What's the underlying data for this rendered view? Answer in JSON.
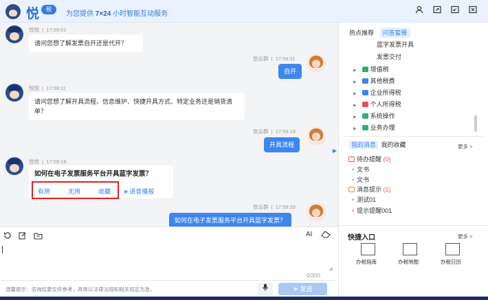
{
  "header": {
    "logo_text": "悦",
    "logo_badge": "税",
    "tagline_prefix": "为您提供",
    "tagline_hours": "7×24",
    "tagline_suffix": "小时智能互动服务",
    "icons": [
      "user-icon",
      "expand-icon",
      "minimize-icon",
      "close-icon"
    ]
  },
  "chat": {
    "messages": [
      {
        "sender": "悦悦",
        "time": "17:59:01",
        "text": "请问您想了解发票自开还是代开？"
      },
      {
        "sender": "张云群",
        "time": "17:59:11",
        "text": "自开"
      },
      {
        "sender": "悦悦",
        "time": "17:59:11",
        "text": "请问您想了解开具流程、信息维护、快捷开具方式、特定业务还是销货清单？"
      },
      {
        "sender": "张云群",
        "time": "17:59:18",
        "text": "开具流程"
      },
      {
        "sender": "悦悦",
        "time": "17:59:18",
        "text": "如何在电子发票服务平台开具蓝字发票？"
      },
      {
        "sender": "张云群",
        "time": "17:59:26",
        "text": "如何在电子发票服务平台开具蓝字发票？"
      }
    ],
    "actions": {
      "useful": "有用",
      "useless": "无用",
      "favorite": "收藏",
      "voice": "语音播报"
    },
    "sep": "|"
  },
  "right_panel": {
    "tabs": [
      "热点推荐",
      "问答套餐"
    ],
    "tree": [
      {
        "label": "蓝字发票开具",
        "indent": true
      },
      {
        "label": "发票交付",
        "indent": true
      },
      {
        "label": "增值税",
        "color": "#2db36b"
      },
      {
        "label": "其他税费",
        "color": "#3d86ef"
      },
      {
        "label": "企业所得税",
        "color": "#3d86ef"
      },
      {
        "label": "个人所得税",
        "color": "#e8534f"
      },
      {
        "label": "系统操作",
        "color": "#2db36b"
      },
      {
        "label": "业务办理",
        "color": "#2db36b"
      }
    ],
    "msg_tabs": [
      "我的消息",
      "我的收藏"
    ],
    "more": "更多 >",
    "todo": {
      "label": "待办提醒",
      "count": "(0)"
    },
    "docs": [
      "文书",
      "文书"
    ],
    "notice": {
      "label": "消息提示",
      "count": "(1)"
    },
    "notice_items": [
      "测试01",
      "提示提醒001"
    ],
    "quick": {
      "title": "快捷入口",
      "more": "更多 >",
      "items": [
        "办税指南",
        "办税地图",
        "办税日历"
      ]
    }
  },
  "input": {
    "ai_label": "AI",
    "counter": "0/300",
    "tip": "温馨提示：咨询结果仅供参考，具体以法律法规和相关规定为准。",
    "send": "发送"
  },
  "colors": {
    "accent": "#3d86ef",
    "highlight_border": "#e02020",
    "chat_bg": "#f3f4f6"
  }
}
